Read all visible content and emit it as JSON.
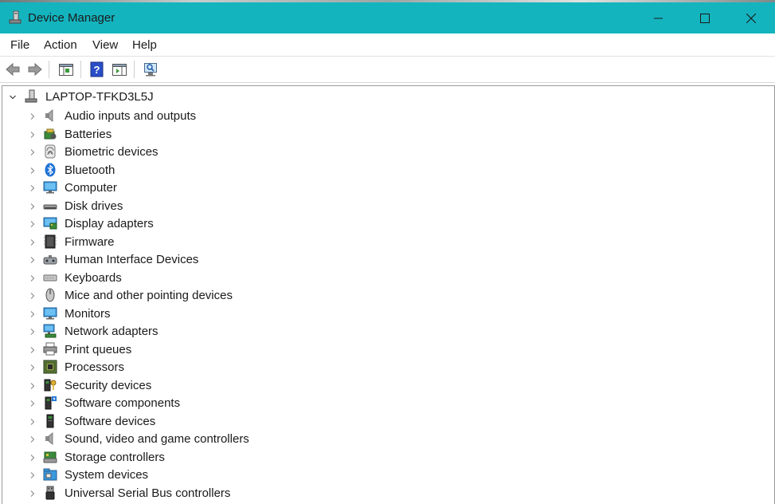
{
  "window": {
    "title": "Device Manager"
  },
  "menu": [
    {
      "label": "File"
    },
    {
      "label": "Action"
    },
    {
      "label": "View"
    },
    {
      "label": "Help"
    }
  ],
  "tree": {
    "root": {
      "label": "LAPTOP-TFKD3L5J",
      "icon": "computer-tower-icon"
    },
    "categories": [
      {
        "label": "Audio inputs and outputs",
        "icon": "speaker-icon"
      },
      {
        "label": "Batteries",
        "icon": "battery-icon"
      },
      {
        "label": "Biometric devices",
        "icon": "fingerprint-icon"
      },
      {
        "label": "Bluetooth",
        "icon": "bluetooth-icon"
      },
      {
        "label": "Computer",
        "icon": "monitor-icon"
      },
      {
        "label": "Disk drives",
        "icon": "disk-drive-icon"
      },
      {
        "label": "Display adapters",
        "icon": "display-adapter-icon"
      },
      {
        "label": "Firmware",
        "icon": "firmware-chip-icon"
      },
      {
        "label": "Human Interface Devices",
        "icon": "hid-icon"
      },
      {
        "label": "Keyboards",
        "icon": "keyboard-icon"
      },
      {
        "label": "Mice and other pointing devices",
        "icon": "mouse-icon"
      },
      {
        "label": "Monitors",
        "icon": "monitor-icon"
      },
      {
        "label": "Network adapters",
        "icon": "network-icon"
      },
      {
        "label": "Print queues",
        "icon": "printer-icon"
      },
      {
        "label": "Processors",
        "icon": "processor-icon"
      },
      {
        "label": "Security devices",
        "icon": "security-key-icon"
      },
      {
        "label": "Software components",
        "icon": "software-component-icon"
      },
      {
        "label": "Software devices",
        "icon": "software-device-icon"
      },
      {
        "label": "Sound, video and game controllers",
        "icon": "speaker-icon"
      },
      {
        "label": "Storage controllers",
        "icon": "storage-controller-icon"
      },
      {
        "label": "System devices",
        "icon": "system-folder-icon"
      },
      {
        "label": "Universal Serial Bus controllers",
        "icon": "usb-icon"
      }
    ]
  },
  "colors": {
    "titlebar": "#14b4bf",
    "accent": "#1e72d6"
  }
}
